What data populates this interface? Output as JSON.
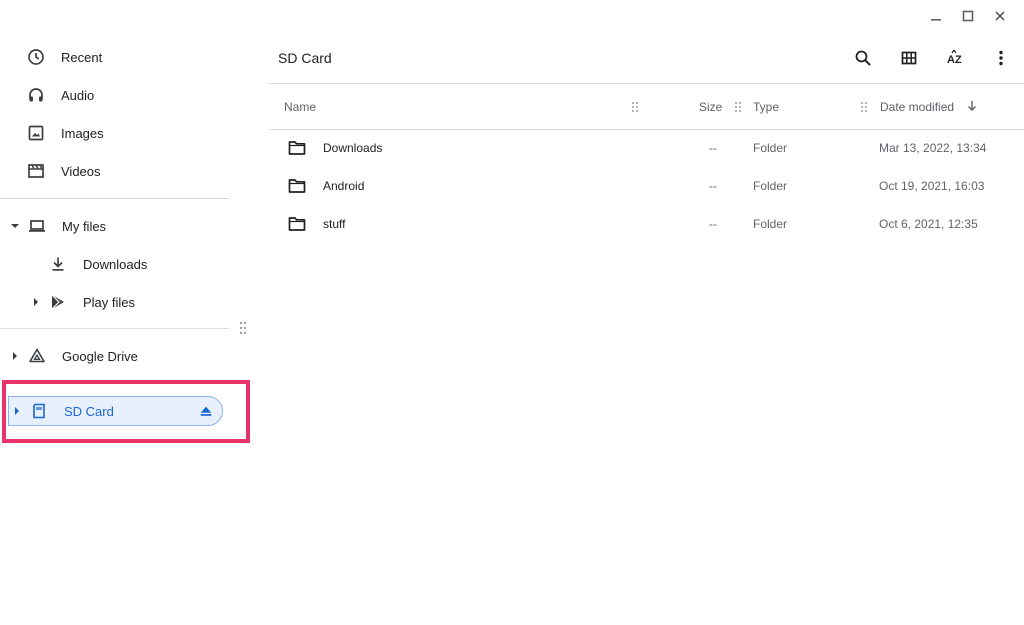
{
  "window_controls": [
    "minimize",
    "maximize",
    "close"
  ],
  "sidebar": {
    "top_items": [
      {
        "label": "Recent",
        "icon": "clock-icon"
      },
      {
        "label": "Audio",
        "icon": "headphones-icon"
      },
      {
        "label": "Images",
        "icon": "image-icon"
      },
      {
        "label": "Videos",
        "icon": "film-icon"
      }
    ],
    "my_files": {
      "label": "My files",
      "icon": "laptop-icon",
      "expanded": true
    },
    "my_files_children": [
      {
        "label": "Downloads",
        "icon": "download-icon"
      },
      {
        "label": "Play files",
        "icon": "play-store-icon"
      }
    ],
    "google_drive": {
      "label": "Google Drive",
      "icon": "drive-icon"
    },
    "sd_card": {
      "label": "SD Card",
      "icon": "sd-card-icon",
      "selected": true
    }
  },
  "main": {
    "title": "SD Card",
    "toolbar": [
      "search-icon",
      "grid-view-icon",
      "sort-az-icon",
      "more-vert-icon"
    ],
    "columns": {
      "name": "Name",
      "size": "Size",
      "type": "Type",
      "date": "Date modified",
      "sort": "descending"
    },
    "rows": [
      {
        "name": "Downloads",
        "size": "--",
        "type": "Folder",
        "date": "Mar 13, 2022, 13:34"
      },
      {
        "name": "Android",
        "size": "--",
        "type": "Folder",
        "date": "Oct 19, 2021, 16:03"
      },
      {
        "name": "stuff",
        "size": "--",
        "type": "Folder",
        "date": "Oct 6, 2021, 12:35"
      }
    ]
  },
  "colors": {
    "accent": "#1967d2",
    "highlight_border": "#e8336b",
    "selected_bg": "#e8f0fe"
  }
}
